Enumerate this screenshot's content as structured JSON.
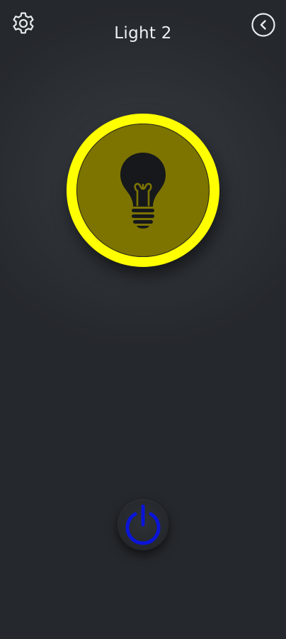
{
  "header": {
    "title": "Light 2",
    "settings_icon": "gear-icon",
    "back_icon": "chevron-left-circle-icon"
  },
  "lamp": {
    "icon": "lightbulb-icon",
    "state": "on",
    "ring_color": "#ffff00",
    "fill_color": "#7d7400"
  },
  "power": {
    "icon": "power-icon",
    "color": "#0a14d8"
  },
  "theme": {
    "background": "#2a2e33",
    "text": "#eef1f4"
  }
}
